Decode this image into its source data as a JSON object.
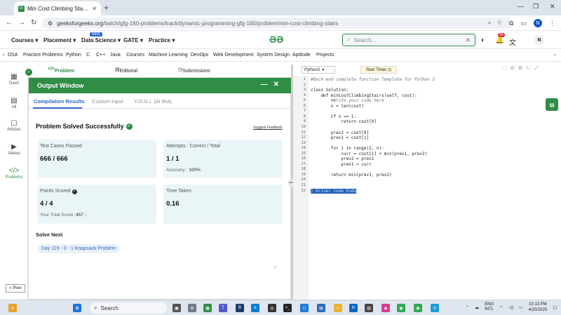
{
  "browser": {
    "tab_title": "Min Cost Climbing Stairs | Prac",
    "url_host": "geeksforgeeks.org",
    "url_path": "/batch/gfg-160-problems/track/dynamic-programming-gfg-160/problem/min-cost-climbing-stairs",
    "profile_initial": "N"
  },
  "gfg_header": {
    "menus": [
      "Courses",
      "Placement",
      "Data Science",
      "GATE",
      "Practice"
    ],
    "new_badge": "NEW",
    "search_placeholder": "Search...",
    "notif_count": "99",
    "profile_initial": "N"
  },
  "categories": [
    "DSA",
    "Practice Problems",
    "Python",
    "C",
    "C++",
    "Java",
    "Courses",
    "Machine Learning",
    "DevOps",
    "Web Development",
    "System Design",
    "Aptitude",
    "Projects"
  ],
  "rail": {
    "items": [
      "Dash",
      "All",
      "Articles",
      "Videos",
      "Problems"
    ],
    "prev_label": "« Prev"
  },
  "problem_tabs": [
    "Problem",
    "Editorial",
    "Submissions"
  ],
  "output": {
    "title": "Output Window",
    "tabs": [
      "Compilation Results",
      "Custom Input",
      "Y.O.G.I. (AI Bot)"
    ],
    "status": "Problem Solved Successfully",
    "feedback": "Suggest Feedback",
    "cards": {
      "tests_label": "Test Cases Passed",
      "tests_value": "666 / 666",
      "attempts_label": "Attempts : Correct / Total",
      "attempts_value": "1 / 1",
      "accuracy_label": "Accuracy :",
      "accuracy_value": "100%",
      "points_label": "Points Scored",
      "points_value": "4 / 4",
      "total_label": "Your Total Score:",
      "total_value": "457",
      "time_label": "Time Taken",
      "time_value": "0.16"
    },
    "solve_next": "Solve Next",
    "next_problem": "Day 119 - 0 - 1 Knapsack Problem"
  },
  "editor": {
    "language": "Python3",
    "timer": "Start Timer",
    "lines": [
      "#Back-end complete function Template for Python 3",
      "",
      "class Solution:",
      "    def minCostClimbingStairs(self, cost):",
      "        #Write your code here",
      "        n = len(cost)",
      "",
      "        if n == 1:",
      "            return cost[0]",
      "",
      "        prev2 = cost[0]",
      "        prev1 = cost[1]",
      "",
      "        for i in range(2, n):",
      "            curr = cost[i] + min(prev1, prev2)",
      "            prev2 = prev1",
      "            prev1 = curr",
      "",
      "        return min(prev1, prev2)",
      "",
      "",
      "} Driver Code Ends"
    ],
    "line_numbers": [
      "1",
      "2",
      "3",
      "4",
      "5",
      "6",
      "7",
      "8",
      "9",
      "10",
      "11",
      "12",
      "13",
      "14",
      "15",
      "16",
      "17",
      "18",
      "19",
      "20",
      "21",
      "22"
    ]
  },
  "taskbar": {
    "search": "Search",
    "lang_1": "ENG",
    "lang_2": "INTL",
    "time": "10:13 PM",
    "date": "4/20/2025"
  }
}
